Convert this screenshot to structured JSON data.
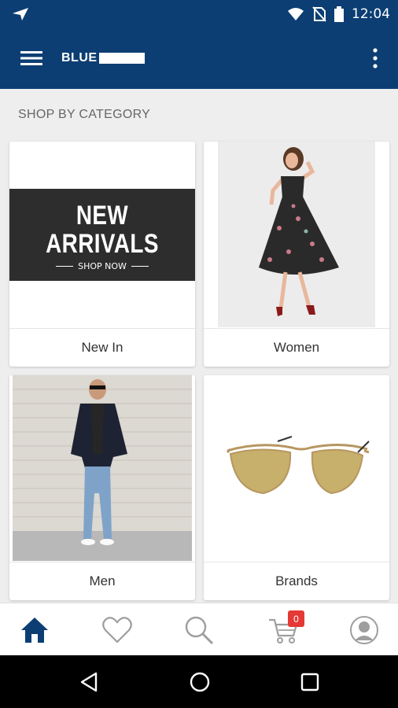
{
  "status_bar": {
    "time": "12:04"
  },
  "app_bar": {
    "logo_text": "BLUE"
  },
  "section": {
    "title": "SHOP BY CATEGORY"
  },
  "categories": [
    {
      "label": "New In",
      "banner": {
        "line1": "NEW",
        "line2": "ARRIVALS",
        "cta": "SHOP NOW"
      }
    },
    {
      "label": "Women"
    },
    {
      "label": "Men"
    },
    {
      "label": "Brands"
    }
  ],
  "bottom_nav": {
    "cart_count": "0"
  },
  "colors": {
    "primary": "#0c3e73",
    "badge": "#e53935"
  },
  "icons": [
    "navigation-arrow-icon",
    "wifi-icon",
    "no-sim-icon",
    "battery-icon",
    "menu-icon",
    "more-vert-icon",
    "home-icon",
    "heart-icon",
    "search-icon",
    "cart-icon",
    "profile-icon",
    "back-icon",
    "home-circle-icon",
    "recents-icon"
  ]
}
